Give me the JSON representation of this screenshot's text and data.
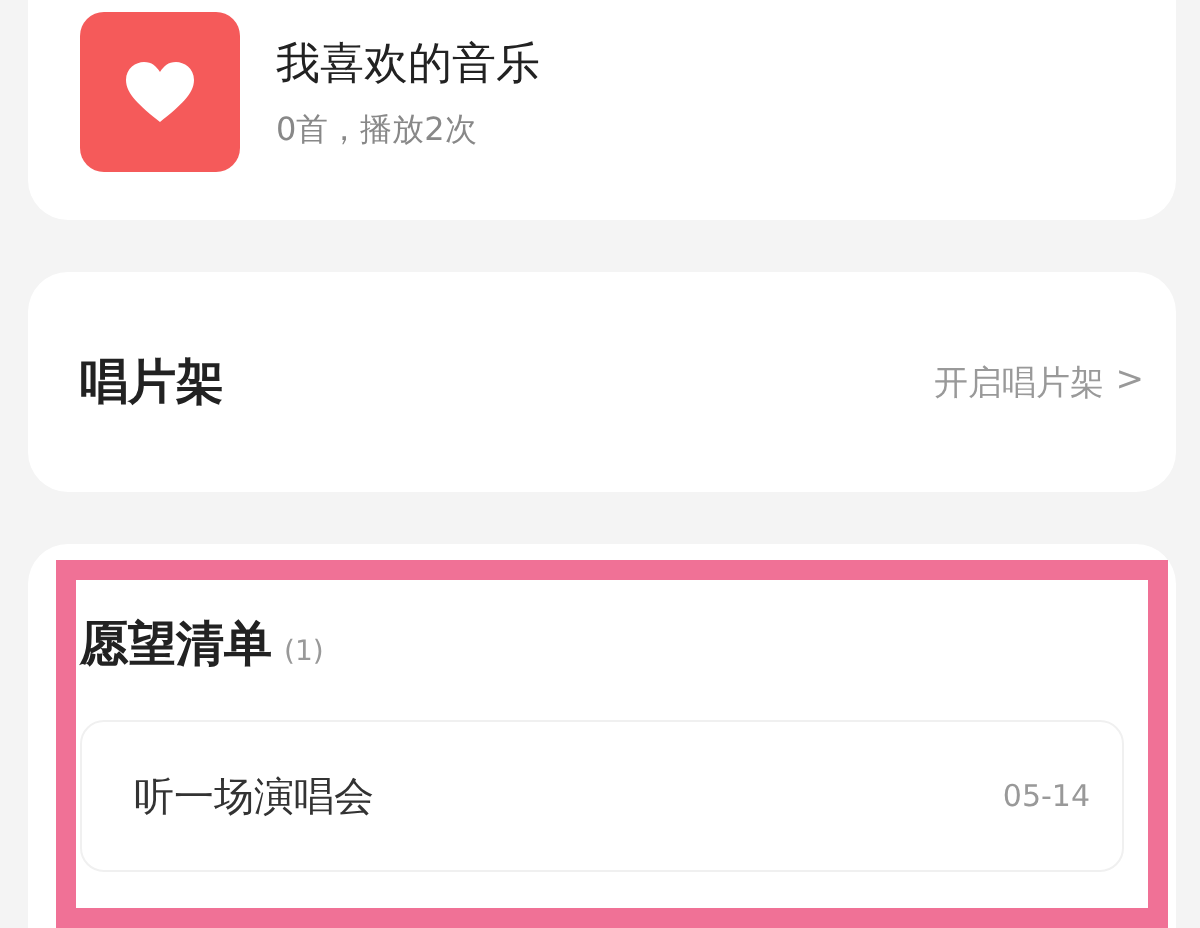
{
  "favorites": {
    "title": "我喜欢的音乐",
    "subtitle": "0首，播放2次"
  },
  "record_shelf": {
    "title": "唱片架",
    "action": "开启唱片架",
    "chevron": ">"
  },
  "wishlist": {
    "title": "愿望清单",
    "count": "(1)",
    "highlighted": true,
    "items": [
      {
        "title": "听一场演唱会",
        "date": "05-14"
      }
    ]
  }
}
